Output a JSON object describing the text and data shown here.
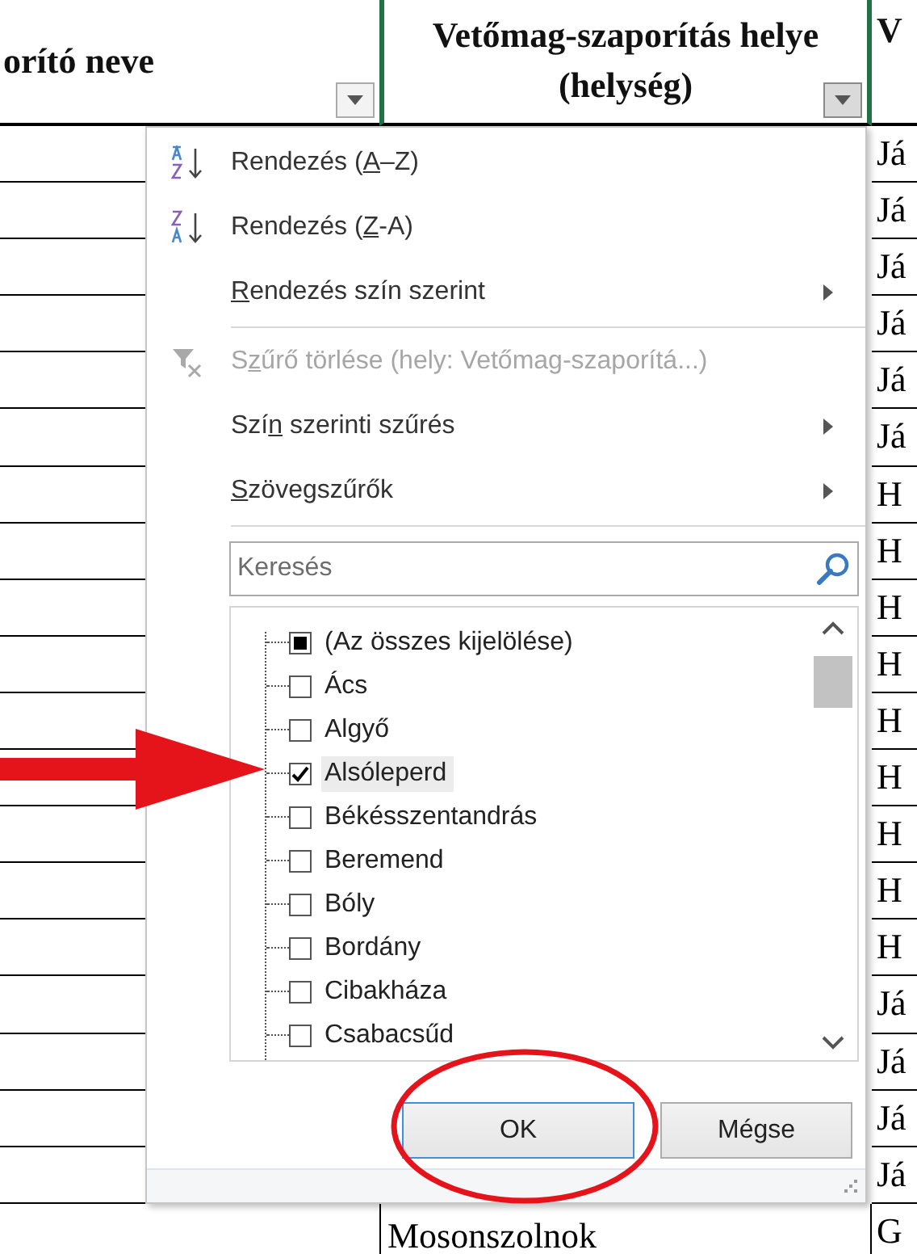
{
  "sheet": {
    "headers": [
      {
        "text": "orító neve",
        "filter_pressed": false
      },
      {
        "text": "Vetőmag-szaporítás helye (helység)",
        "filter_pressed": true
      },
      {
        "text": "V"
      }
    ],
    "rows": [
      {
        "column_3": "Já"
      },
      {
        "column_3": "Já"
      },
      {
        "column_3": "Já"
      },
      {
        "column_3": "Já"
      },
      {
        "column_3": "Já"
      },
      {
        "column_3": "Já"
      },
      {
        "column_3": "H"
      },
      {
        "column_3": "H"
      },
      {
        "column_3": "H"
      },
      {
        "column_3": "H"
      },
      {
        "column_3": "H"
      },
      {
        "column_3": "H"
      },
      {
        "column_3": "H"
      },
      {
        "column_3": "H"
      },
      {
        "column_3": "H"
      },
      {
        "column_3": "Já"
      },
      {
        "column_3": "Já"
      },
      {
        "column_3": "Já"
      },
      {
        "column_3": "Já"
      },
      {
        "column_2": "Mosonszolnok",
        "column_3": "G"
      }
    ]
  },
  "filter_menu": {
    "items": [
      {
        "kind": "sort-ascending",
        "before": "Rendezés (",
        "accelerator": "A",
        "after": "–Z)",
        "disabled": false,
        "submenu": false
      },
      {
        "kind": "sort-descending",
        "before": "Rendezés (",
        "accelerator": "Z",
        "after": "-A)",
        "disabled": false,
        "submenu": false
      },
      {
        "kind": "plain",
        "accelerator": "R",
        "after": "endezés szín szerint",
        "disabled": false,
        "submenu": true
      },
      {
        "kind": "separator"
      },
      {
        "kind": "clear-filter",
        "before": "S",
        "accelerator": "z",
        "after": "űrő törlése (hely: Vetőmag-szaporítá...)",
        "disabled": true,
        "submenu": false
      },
      {
        "kind": "plain",
        "before": "Szí",
        "accelerator": "n",
        "after": " szerinti szűrés",
        "disabled": false,
        "submenu": true
      },
      {
        "kind": "plain",
        "accelerator": "S",
        "after": "zövegszűrők",
        "disabled": false,
        "submenu": true
      },
      {
        "kind": "separator"
      }
    ],
    "search": {
      "placeholder": "Keresés"
    },
    "values": [
      {
        "label": "(Az összes kijelölése)",
        "checked": false,
        "indeterminate": true,
        "selected": false
      },
      {
        "label": "Ács",
        "checked": false,
        "indeterminate": false,
        "selected": false
      },
      {
        "label": "Algyő",
        "checked": false,
        "indeterminate": false,
        "selected": false
      },
      {
        "label": "Alsóleperd",
        "checked": true,
        "indeterminate": false,
        "selected": true
      },
      {
        "label": "Békésszentandrás",
        "checked": false,
        "indeterminate": false,
        "selected": false
      },
      {
        "label": "Beremend",
        "checked": false,
        "indeterminate": false,
        "selected": false
      },
      {
        "label": "Bóly",
        "checked": false,
        "indeterminate": false,
        "selected": false
      },
      {
        "label": "Bordány",
        "checked": false,
        "indeterminate": false,
        "selected": false
      },
      {
        "label": "Cibakháza",
        "checked": false,
        "indeterminate": false,
        "selected": false
      },
      {
        "label": "Csabacsűd",
        "checked": false,
        "indeterminate": false,
        "selected": false
      }
    ],
    "buttons": [
      {
        "label": "OK",
        "default": true
      },
      {
        "label": "Mégse",
        "default": false
      }
    ]
  }
}
